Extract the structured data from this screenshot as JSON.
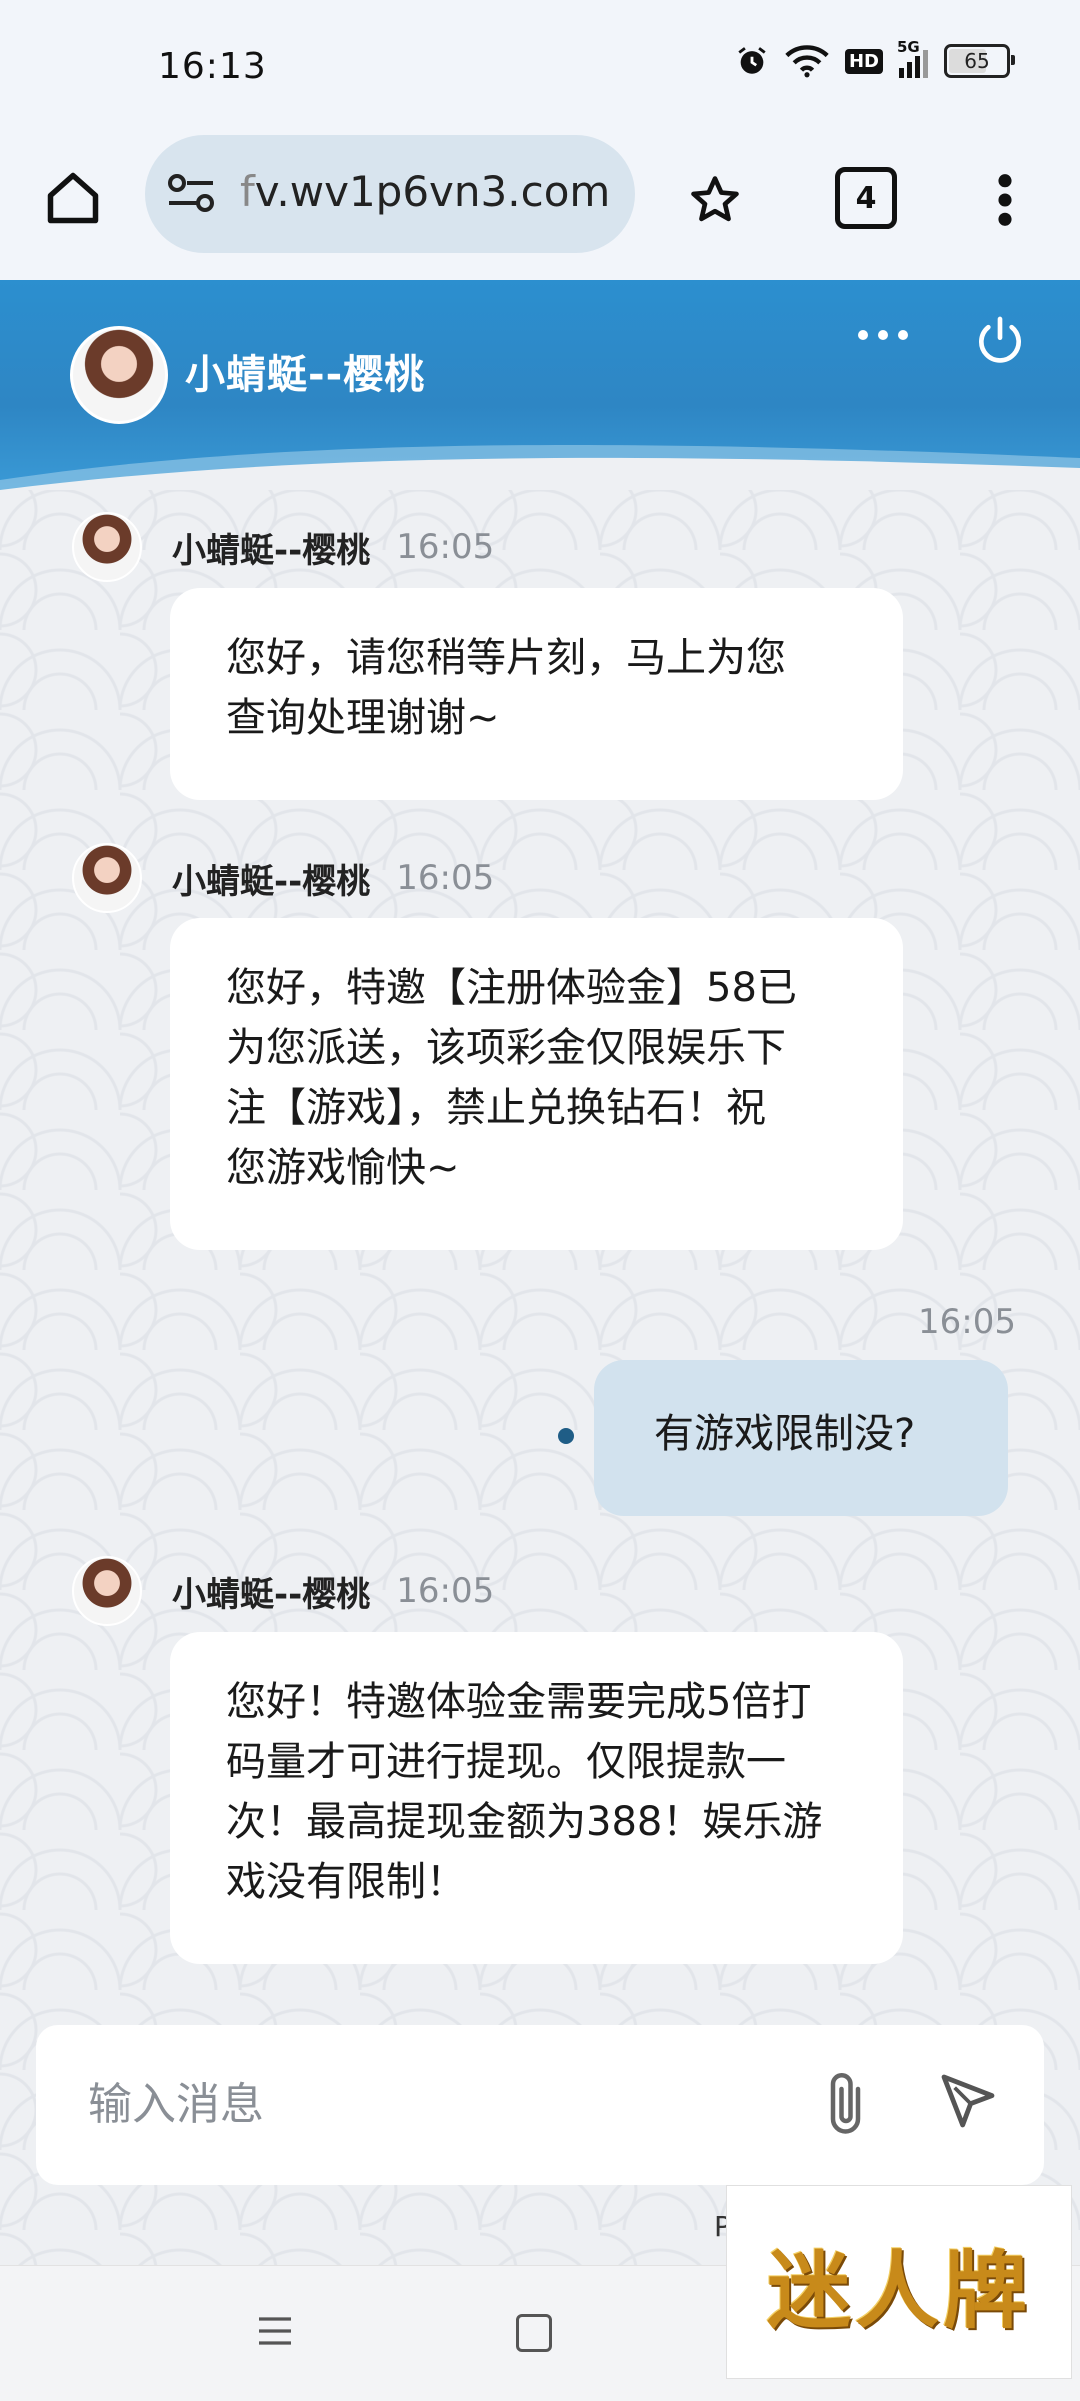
{
  "status_bar": {
    "time": "16:13",
    "network_label": "5G",
    "hd_label": "HD",
    "battery": "65"
  },
  "browser": {
    "url_prefix": "f",
    "url": "v.wv1p6vn3.com",
    "tab_count": "4"
  },
  "chat": {
    "agent_name": "小蜻蜓--樱桃",
    "messages": [
      {
        "sender": "小蜻蜓--樱桃",
        "time": "16:05",
        "lines": [
          "您好，请您稍等片刻，马上为您",
          "查询处理谢谢~"
        ]
      },
      {
        "sender": "小蜻蜓--樱桃",
        "time": "16:05",
        "lines": [
          "您好，特邀【注册体验金】58已",
          "为您派送，该项彩金仅限娱乐下",
          "注【游戏】，禁止兑换钻石！祝",
          "您游戏愉快~"
        ]
      },
      {
        "sender": "me",
        "time": "16:05",
        "lines": [
          "有游戏限制没?"
        ]
      },
      {
        "sender": "小蜻蜓--樱桃",
        "time": "16:05",
        "lines": [
          "您好！特邀体验金需要完成5倍打",
          "码量才可进行提现。仅限提款一",
          "次！最高提现金额为388！娱乐游",
          "戏没有限制！"
        ]
      }
    ],
    "input_placeholder": "输入消息",
    "powered_fragment": "P"
  },
  "watermark": {
    "text": "迷人牌"
  },
  "colors": {
    "header_blue": "#2c8fcf",
    "my_bubble": "#d2e2ee",
    "sent_dot": "#1f5d86"
  }
}
